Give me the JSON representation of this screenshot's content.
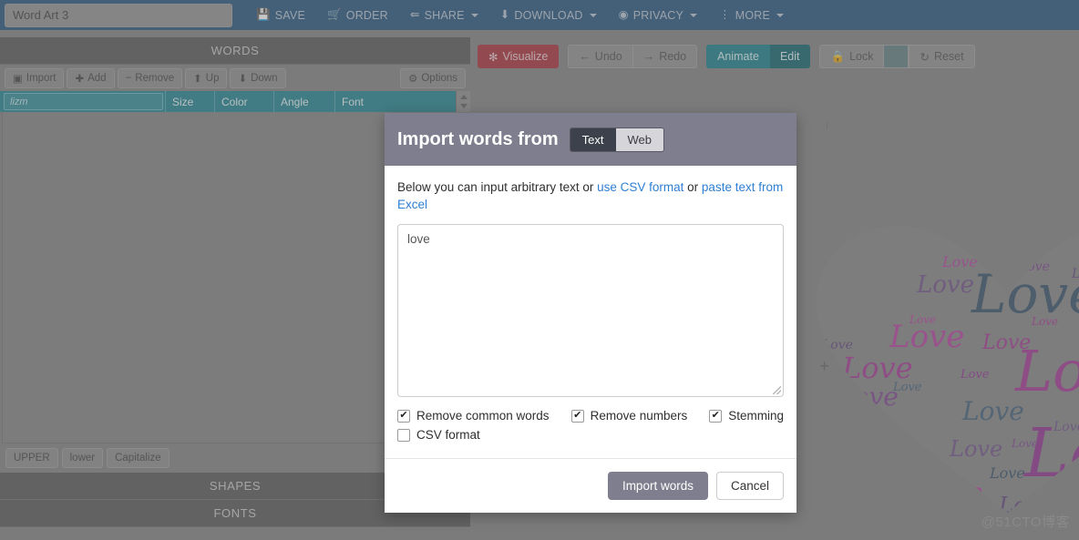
{
  "topbar": {
    "project_title": "Word Art 3",
    "nav": [
      {
        "label": "SAVE",
        "icon": "save-icon",
        "glyph": "💾",
        "caret": false
      },
      {
        "label": "ORDER",
        "icon": "cart-icon",
        "glyph": "🛒",
        "caret": false
      },
      {
        "label": "SHARE",
        "icon": "share-icon",
        "glyph": "↱",
        "caret": true
      },
      {
        "label": "DOWNLOAD",
        "icon": "download-icon",
        "glyph": "⬇",
        "caret": true
      },
      {
        "label": "PRIVACY",
        "icon": "eye-icon",
        "glyph": "◉",
        "caret": true
      },
      {
        "label": "MORE",
        "icon": "dots-vertical-icon",
        "glyph": "⋮",
        "caret": true
      }
    ]
  },
  "left_panel": {
    "words_header": "WORDS",
    "toolbar": [
      {
        "label": "Import",
        "icon": "import-icon",
        "glyph": "⬚"
      },
      {
        "label": "Add",
        "icon": "plus-icon",
        "glyph": "＋"
      },
      {
        "label": "Remove",
        "icon": "minus-icon",
        "glyph": "−"
      },
      {
        "label": "Up",
        "icon": "arrow-up-icon",
        "glyph": "⬆"
      },
      {
        "label": "Down",
        "icon": "arrow-down-icon",
        "glyph": "⬇"
      }
    ],
    "options_label": "Options",
    "options_icon": "gear-icon",
    "grid": {
      "filter_placeholder": "lizm",
      "columns": [
        "Size",
        "Color",
        "Angle",
        "Font"
      ],
      "rows": []
    },
    "case_buttons": [
      "UPPER",
      "lower",
      "Capitalize"
    ],
    "shapes_header": "SHAPES",
    "fonts_header": "FONTS"
  },
  "canvas": {
    "toolbar": {
      "visualize": "Visualize",
      "visualize_icon": "sparkle-icon",
      "undo": "Undo",
      "undo_icon": "arrow-left-icon",
      "redo": "Redo",
      "redo_icon": "arrow-right-icon",
      "animate": "Animate",
      "edit": "Edit",
      "lock": "Lock",
      "lock_icon": "lock-icon",
      "color_swatch": "#5e7b7e",
      "reset": "Reset",
      "reset_icon": "refresh-icon"
    },
    "word": "Love",
    "background": "#7f7f7f",
    "palette": [
      "#8e2a8e",
      "#a0308f",
      "#b4389c",
      "#7a3d8e",
      "#6b4b86",
      "#2f4a63",
      "#3c5a75",
      "#5c3f7a"
    ],
    "watermark": "@51CTO博客"
  },
  "modal": {
    "title": "Import words from",
    "tabs": [
      {
        "label": "Text",
        "active": true
      },
      {
        "label": "Web",
        "active": false
      }
    ],
    "description_prefix": "Below you can input arbitrary text or ",
    "link_csv": "use CSV format",
    "description_mid": " or ",
    "link_excel": "paste text from Excel",
    "textarea_value": "love",
    "options": [
      {
        "label": "Remove common words",
        "checked": true
      },
      {
        "label": "Remove numbers",
        "checked": true
      },
      {
        "label": "Stemming",
        "checked": true
      },
      {
        "label": "CSV format",
        "checked": false
      }
    ],
    "primary_button": "Import words",
    "cancel_button": "Cancel",
    "check_glyph": "✔"
  }
}
